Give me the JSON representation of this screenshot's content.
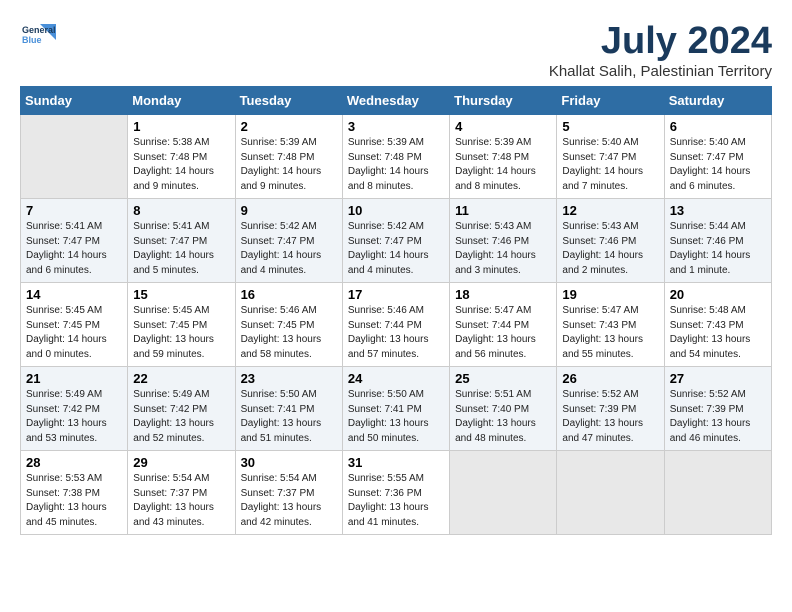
{
  "header": {
    "logo_line1": "General",
    "logo_line2": "Blue",
    "month_year": "July 2024",
    "location": "Khallat Salih, Palestinian Territory"
  },
  "columns": [
    "Sunday",
    "Monday",
    "Tuesday",
    "Wednesday",
    "Thursday",
    "Friday",
    "Saturday"
  ],
  "weeks": [
    [
      {
        "day": "",
        "empty": true
      },
      {
        "day": "1",
        "sunrise": "Sunrise: 5:38 AM",
        "sunset": "Sunset: 7:48 PM",
        "daylight": "Daylight: 14 hours and 9 minutes."
      },
      {
        "day": "2",
        "sunrise": "Sunrise: 5:39 AM",
        "sunset": "Sunset: 7:48 PM",
        "daylight": "Daylight: 14 hours and 9 minutes."
      },
      {
        "day": "3",
        "sunrise": "Sunrise: 5:39 AM",
        "sunset": "Sunset: 7:48 PM",
        "daylight": "Daylight: 14 hours and 8 minutes."
      },
      {
        "day": "4",
        "sunrise": "Sunrise: 5:39 AM",
        "sunset": "Sunset: 7:48 PM",
        "daylight": "Daylight: 14 hours and 8 minutes."
      },
      {
        "day": "5",
        "sunrise": "Sunrise: 5:40 AM",
        "sunset": "Sunset: 7:47 PM",
        "daylight": "Daylight: 14 hours and 7 minutes."
      },
      {
        "day": "6",
        "sunrise": "Sunrise: 5:40 AM",
        "sunset": "Sunset: 7:47 PM",
        "daylight": "Daylight: 14 hours and 6 minutes."
      }
    ],
    [
      {
        "day": "7",
        "sunrise": "Sunrise: 5:41 AM",
        "sunset": "Sunset: 7:47 PM",
        "daylight": "Daylight: 14 hours and 6 minutes."
      },
      {
        "day": "8",
        "sunrise": "Sunrise: 5:41 AM",
        "sunset": "Sunset: 7:47 PM",
        "daylight": "Daylight: 14 hours and 5 minutes."
      },
      {
        "day": "9",
        "sunrise": "Sunrise: 5:42 AM",
        "sunset": "Sunset: 7:47 PM",
        "daylight": "Daylight: 14 hours and 4 minutes."
      },
      {
        "day": "10",
        "sunrise": "Sunrise: 5:42 AM",
        "sunset": "Sunset: 7:47 PM",
        "daylight": "Daylight: 14 hours and 4 minutes."
      },
      {
        "day": "11",
        "sunrise": "Sunrise: 5:43 AM",
        "sunset": "Sunset: 7:46 PM",
        "daylight": "Daylight: 14 hours and 3 minutes."
      },
      {
        "day": "12",
        "sunrise": "Sunrise: 5:43 AM",
        "sunset": "Sunset: 7:46 PM",
        "daylight": "Daylight: 14 hours and 2 minutes."
      },
      {
        "day": "13",
        "sunrise": "Sunrise: 5:44 AM",
        "sunset": "Sunset: 7:46 PM",
        "daylight": "Daylight: 14 hours and 1 minute."
      }
    ],
    [
      {
        "day": "14",
        "sunrise": "Sunrise: 5:45 AM",
        "sunset": "Sunset: 7:45 PM",
        "daylight": "Daylight: 14 hours and 0 minutes."
      },
      {
        "day": "15",
        "sunrise": "Sunrise: 5:45 AM",
        "sunset": "Sunset: 7:45 PM",
        "daylight": "Daylight: 13 hours and 59 minutes."
      },
      {
        "day": "16",
        "sunrise": "Sunrise: 5:46 AM",
        "sunset": "Sunset: 7:45 PM",
        "daylight": "Daylight: 13 hours and 58 minutes."
      },
      {
        "day": "17",
        "sunrise": "Sunrise: 5:46 AM",
        "sunset": "Sunset: 7:44 PM",
        "daylight": "Daylight: 13 hours and 57 minutes."
      },
      {
        "day": "18",
        "sunrise": "Sunrise: 5:47 AM",
        "sunset": "Sunset: 7:44 PM",
        "daylight": "Daylight: 13 hours and 56 minutes."
      },
      {
        "day": "19",
        "sunrise": "Sunrise: 5:47 AM",
        "sunset": "Sunset: 7:43 PM",
        "daylight": "Daylight: 13 hours and 55 minutes."
      },
      {
        "day": "20",
        "sunrise": "Sunrise: 5:48 AM",
        "sunset": "Sunset: 7:43 PM",
        "daylight": "Daylight: 13 hours and 54 minutes."
      }
    ],
    [
      {
        "day": "21",
        "sunrise": "Sunrise: 5:49 AM",
        "sunset": "Sunset: 7:42 PM",
        "daylight": "Daylight: 13 hours and 53 minutes."
      },
      {
        "day": "22",
        "sunrise": "Sunrise: 5:49 AM",
        "sunset": "Sunset: 7:42 PM",
        "daylight": "Daylight: 13 hours and 52 minutes."
      },
      {
        "day": "23",
        "sunrise": "Sunrise: 5:50 AM",
        "sunset": "Sunset: 7:41 PM",
        "daylight": "Daylight: 13 hours and 51 minutes."
      },
      {
        "day": "24",
        "sunrise": "Sunrise: 5:50 AM",
        "sunset": "Sunset: 7:41 PM",
        "daylight": "Daylight: 13 hours and 50 minutes."
      },
      {
        "day": "25",
        "sunrise": "Sunrise: 5:51 AM",
        "sunset": "Sunset: 7:40 PM",
        "daylight": "Daylight: 13 hours and 48 minutes."
      },
      {
        "day": "26",
        "sunrise": "Sunrise: 5:52 AM",
        "sunset": "Sunset: 7:39 PM",
        "daylight": "Daylight: 13 hours and 47 minutes."
      },
      {
        "day": "27",
        "sunrise": "Sunrise: 5:52 AM",
        "sunset": "Sunset: 7:39 PM",
        "daylight": "Daylight: 13 hours and 46 minutes."
      }
    ],
    [
      {
        "day": "28",
        "sunrise": "Sunrise: 5:53 AM",
        "sunset": "Sunset: 7:38 PM",
        "daylight": "Daylight: 13 hours and 45 minutes."
      },
      {
        "day": "29",
        "sunrise": "Sunrise: 5:54 AM",
        "sunset": "Sunset: 7:37 PM",
        "daylight": "Daylight: 13 hours and 43 minutes."
      },
      {
        "day": "30",
        "sunrise": "Sunrise: 5:54 AM",
        "sunset": "Sunset: 7:37 PM",
        "daylight": "Daylight: 13 hours and 42 minutes."
      },
      {
        "day": "31",
        "sunrise": "Sunrise: 5:55 AM",
        "sunset": "Sunset: 7:36 PM",
        "daylight": "Daylight: 13 hours and 41 minutes."
      },
      {
        "day": "",
        "empty": true
      },
      {
        "day": "",
        "empty": true
      },
      {
        "day": "",
        "empty": true
      }
    ]
  ]
}
